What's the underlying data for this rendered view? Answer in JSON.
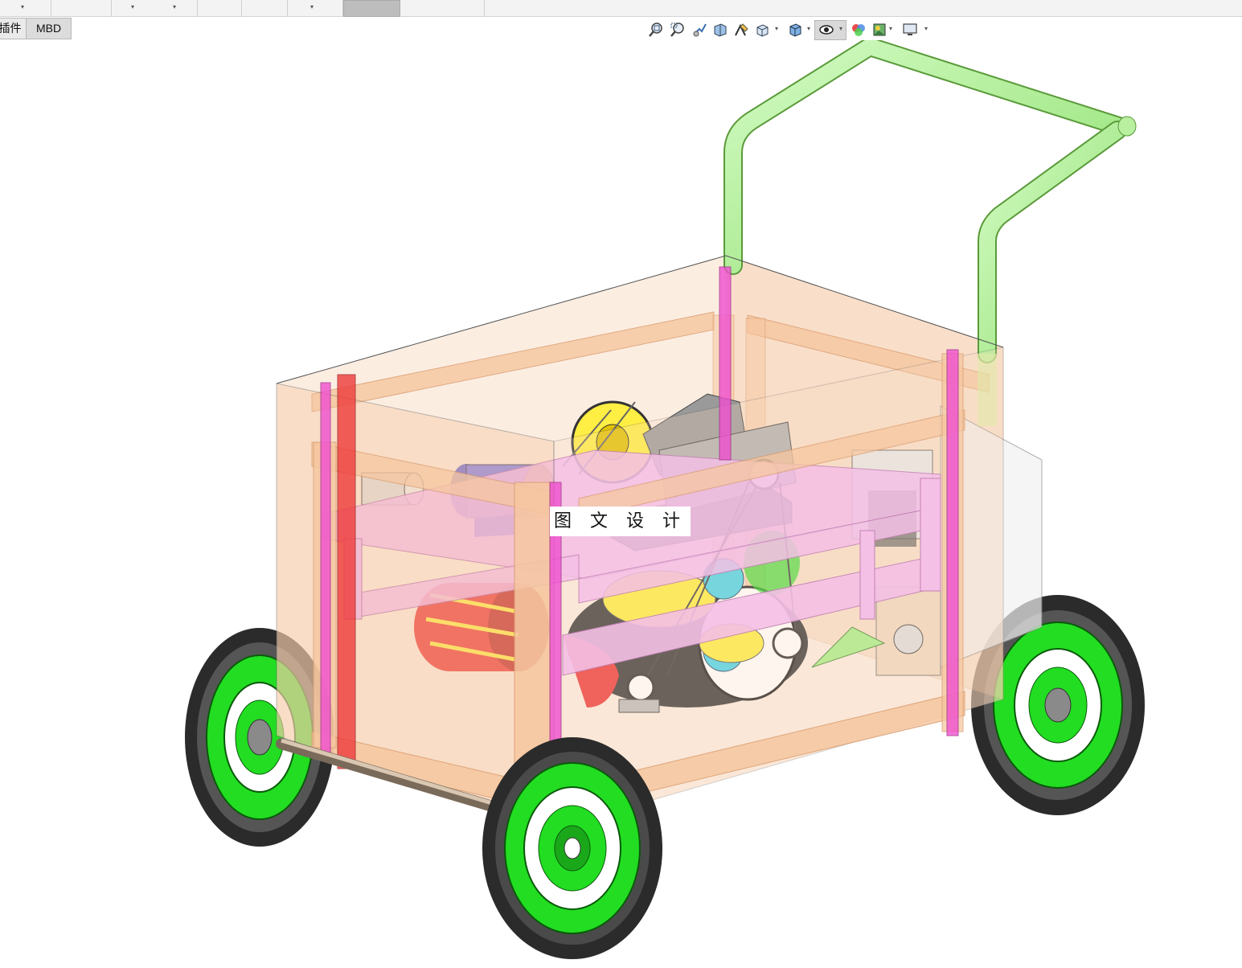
{
  "command_strip": {
    "segments": [
      "",
      "",
      "",
      "",
      "",
      "",
      "",
      "",
      "",
      "",
      ""
    ]
  },
  "tabs": [
    {
      "label": "插件",
      "active": false
    },
    {
      "label": "MBD",
      "active": true
    }
  ],
  "view_toolbar": {
    "icons": [
      "zoom-to-fit-icon",
      "zoom-to-area-icon",
      "previous-view-icon",
      "section-view-icon",
      "dynamic-annotation-icon",
      "view-orientation-icon",
      "display-style-icon",
      "hide-show-items-icon",
      "edit-appearance-icon",
      "apply-scene-icon",
      "view-settings-icon"
    ]
  },
  "model": {
    "watermark": "图 文 设 计"
  },
  "colors": {
    "frame": "#f6c7a0",
    "frame_edge": "#d99a6c",
    "pink_frame": "#f4b8f4",
    "handle": "#a8f08a",
    "wheel_rim": "#22dd22",
    "tire": "#2b2b2b",
    "motor_blue": "#7e7ee8",
    "red_part": "#ee3b3b",
    "yellow_part": "#ffee44",
    "cyan_part": "#4ad5e8",
    "gray_part": "#9a9a9a"
  }
}
